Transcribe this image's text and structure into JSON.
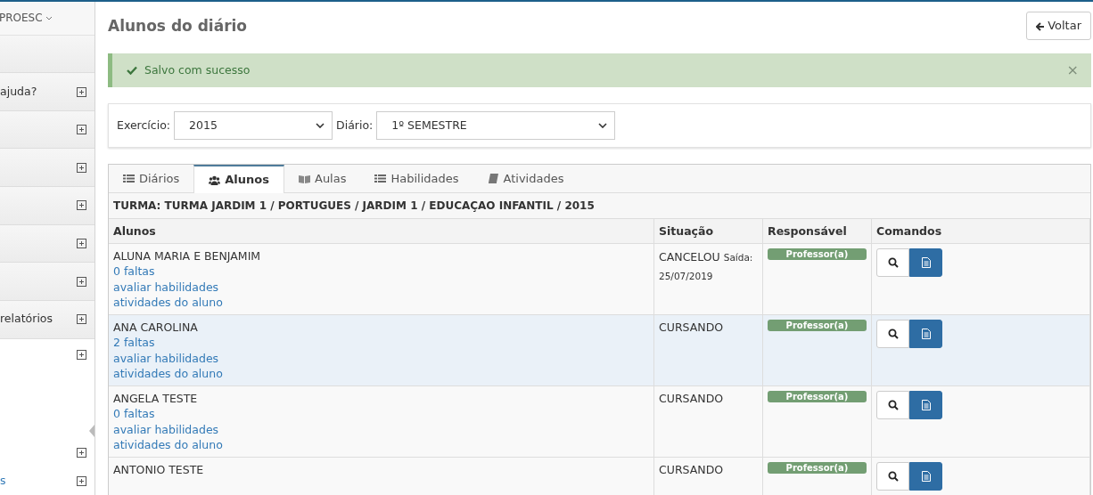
{
  "sidebar": {
    "brand": "PROESC",
    "items": [
      {
        "expandable": false,
        "kind": "shaded"
      },
      {
        "label": "ajuda?",
        "expandable": true,
        "kind": "shaded"
      },
      {
        "expandable": true,
        "kind": "shaded"
      },
      {
        "expandable": true,
        "kind": "shaded"
      },
      {
        "expandable": true,
        "kind": "shaded"
      },
      {
        "expandable": true,
        "kind": "shaded"
      },
      {
        "expandable": true,
        "kind": "shaded"
      },
      {
        "label": "relatórios",
        "expandable": true,
        "kind": "shaded"
      },
      {
        "expandable": true,
        "kind": "tall"
      },
      {
        "expandable": true,
        "kind": "plain"
      },
      {
        "label": "s",
        "expandable": true,
        "kind": "plain"
      }
    ]
  },
  "page": {
    "title": "Alunos do diário",
    "back_button": "Voltar"
  },
  "alert": {
    "message": "Salvo com sucesso",
    "close": "×"
  },
  "filters": [
    {
      "label": "Exercício:",
      "value": "2015"
    },
    {
      "label": "Diário:",
      "value": "1º SEMESTRE"
    }
  ],
  "tabs": [
    {
      "label": "Diários",
      "kind": "list",
      "selected": false
    },
    {
      "label": "Alunos",
      "kind": "users",
      "selected": true
    },
    {
      "label": "Aulas",
      "kind": "openbook",
      "selected": false
    },
    {
      "label": "Habilidades",
      "kind": "list",
      "selected": false
    },
    {
      "label": "Atividades",
      "kind": "book",
      "selected": false
    }
  ],
  "table": {
    "caption": "TURMA: TURMA JARDIM 1 / PORTUGUES / JARDIM 1 / EDUCAÇAO INFANTIL / 2015",
    "columns": [
      "Alunos",
      "Situação",
      "Responsável",
      "Comandos"
    ],
    "rows": [
      {
        "name": "ALUNA MARIA E BENJAMIM",
        "links": [
          "0 faltas",
          "avaliar habilidades",
          "atividades do aluno"
        ],
        "status": "CANCELOU",
        "status_note": "Saída: 25/07/2019",
        "responsible": "Professor(a)",
        "highlighted": false
      },
      {
        "name": "ANA CAROLINA",
        "links": [
          "2 faltas",
          "avaliar habilidades",
          "atividades do aluno"
        ],
        "status": "CURSANDO",
        "status_note": "",
        "responsible": "Professor(a)",
        "highlighted": true
      },
      {
        "name": "ANGELA TESTE",
        "links": [
          "0 faltas",
          "avaliar habilidades",
          "atividades do aluno"
        ],
        "status": "CURSANDO",
        "status_note": "",
        "responsible": "Professor(a)",
        "highlighted": false
      },
      {
        "name": "ANTONIO TESTE",
        "links": [],
        "status": "CURSANDO",
        "status_note": "",
        "responsible": "Professor(a)",
        "highlighted": false
      }
    ]
  }
}
